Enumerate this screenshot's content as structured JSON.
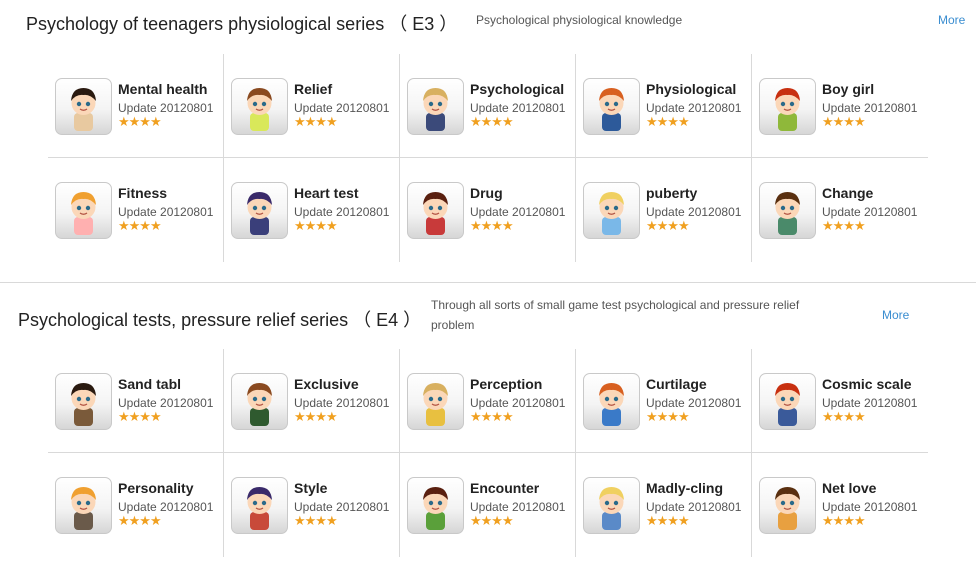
{
  "sections": [
    {
      "id": "E3",
      "title": "Psychology of teenagers physiological series （ E3 ）",
      "description": "Psychological physiological knowledge",
      "more_label": "More",
      "apps": [
        {
          "name": "Mental health",
          "update": "Update 20120801",
          "stars": "★★★★",
          "icon": "boy-avatar-icon",
          "accent": "#e8c9a0"
        },
        {
          "name": "Relief",
          "update": "Update 20120801",
          "stars": "★★★★",
          "icon": "girl-avatar-icon",
          "accent": "#d9e85a"
        },
        {
          "name": "Psychological",
          "update": "Update 20120801",
          "stars": "★★★★",
          "icon": "blond-boy-avatar-icon",
          "accent": "#3b4a7a"
        },
        {
          "name": "Physiological",
          "update": "Update 20120801",
          "stars": "★★★★",
          "icon": "redhead-boy-avatar-icon",
          "accent": "#2d5a9a"
        },
        {
          "name": "Boy girl",
          "update": "Update 20120801",
          "stars": "★★★★",
          "icon": "curly-girl-avatar-icon",
          "accent": "#8fb83a"
        },
        {
          "name": "Fitness",
          "update": "Update 20120801",
          "stars": "★★★★",
          "icon": "orange-hair-boy-avatar-icon",
          "accent": "#ffb0b0"
        },
        {
          "name": "Heart test",
          "update": "Update 20120801",
          "stars": "★★★★",
          "icon": "ninja-avatar-icon",
          "accent": "#3a3f7a"
        },
        {
          "name": "Drug",
          "update": "Update 20120801",
          "stars": "★★★★",
          "icon": "long-hair-girl-avatar-icon",
          "accent": "#c83a3a"
        },
        {
          "name": "puberty",
          "update": "Update 20120801",
          "stars": "★★★★",
          "icon": "blonde-girl-avatar-icon",
          "accent": "#7ab8e8"
        },
        {
          "name": "Change",
          "update": "Update 20120801",
          "stars": "★★★★",
          "icon": "brown-hair-boy-avatar-icon",
          "accent": "#4a8a6a"
        }
      ]
    },
    {
      "id": "E4",
      "title": "Psychological tests, pressure relief series （ E4 ）",
      "description": "Through all sorts of small game test psychological and pressure relief problem",
      "more_label": "More",
      "apps": [
        {
          "name": "Sand tabl",
          "update": "Update 20120801",
          "stars": "★★★★",
          "icon": "twins-icon",
          "accent": "#7a5a3a"
        },
        {
          "name": "Exclusive",
          "update": "Update 20120801",
          "stars": "★★★★",
          "icon": "teacher-blackboard-icon",
          "accent": "#2f5a2f"
        },
        {
          "name": "Perception",
          "update": "Update 20120801",
          "stars": "★★★★",
          "icon": "child-lying-icon",
          "accent": "#e8c040"
        },
        {
          "name": "Curtilage",
          "update": "Update 20120801",
          "stars": "★★★★",
          "icon": "backpack-icon",
          "accent": "#3a7ac8"
        },
        {
          "name": "Cosmic scale",
          "update": "Update 20120801",
          "stars": "★★★★",
          "icon": "running-kid-icon",
          "accent": "#3a5a9a"
        },
        {
          "name": "Personality",
          "update": "Update 20120801",
          "stars": "★★★★",
          "icon": "thinking-man-icon",
          "accent": "#6a5a4a"
        },
        {
          "name": "Style",
          "update": "Update 20120801",
          "stars": "★★★★",
          "icon": "grumpy-face-icon",
          "accent": "#c84a3a"
        },
        {
          "name": "Encounter",
          "update": "Update 20120801",
          "stars": "★★★★",
          "icon": "girl-backpack-icon",
          "accent": "#5aa03a"
        },
        {
          "name": "Madly-cling",
          "update": "Update 20120801",
          "stars": "★★★★",
          "icon": "painter-kid-icon",
          "accent": "#5a8ac8"
        },
        {
          "name": "Net love",
          "update": "Update 20120801",
          "stars": "★★★★",
          "icon": "couple-kids-icon",
          "accent": "#e8a040"
        }
      ]
    }
  ]
}
